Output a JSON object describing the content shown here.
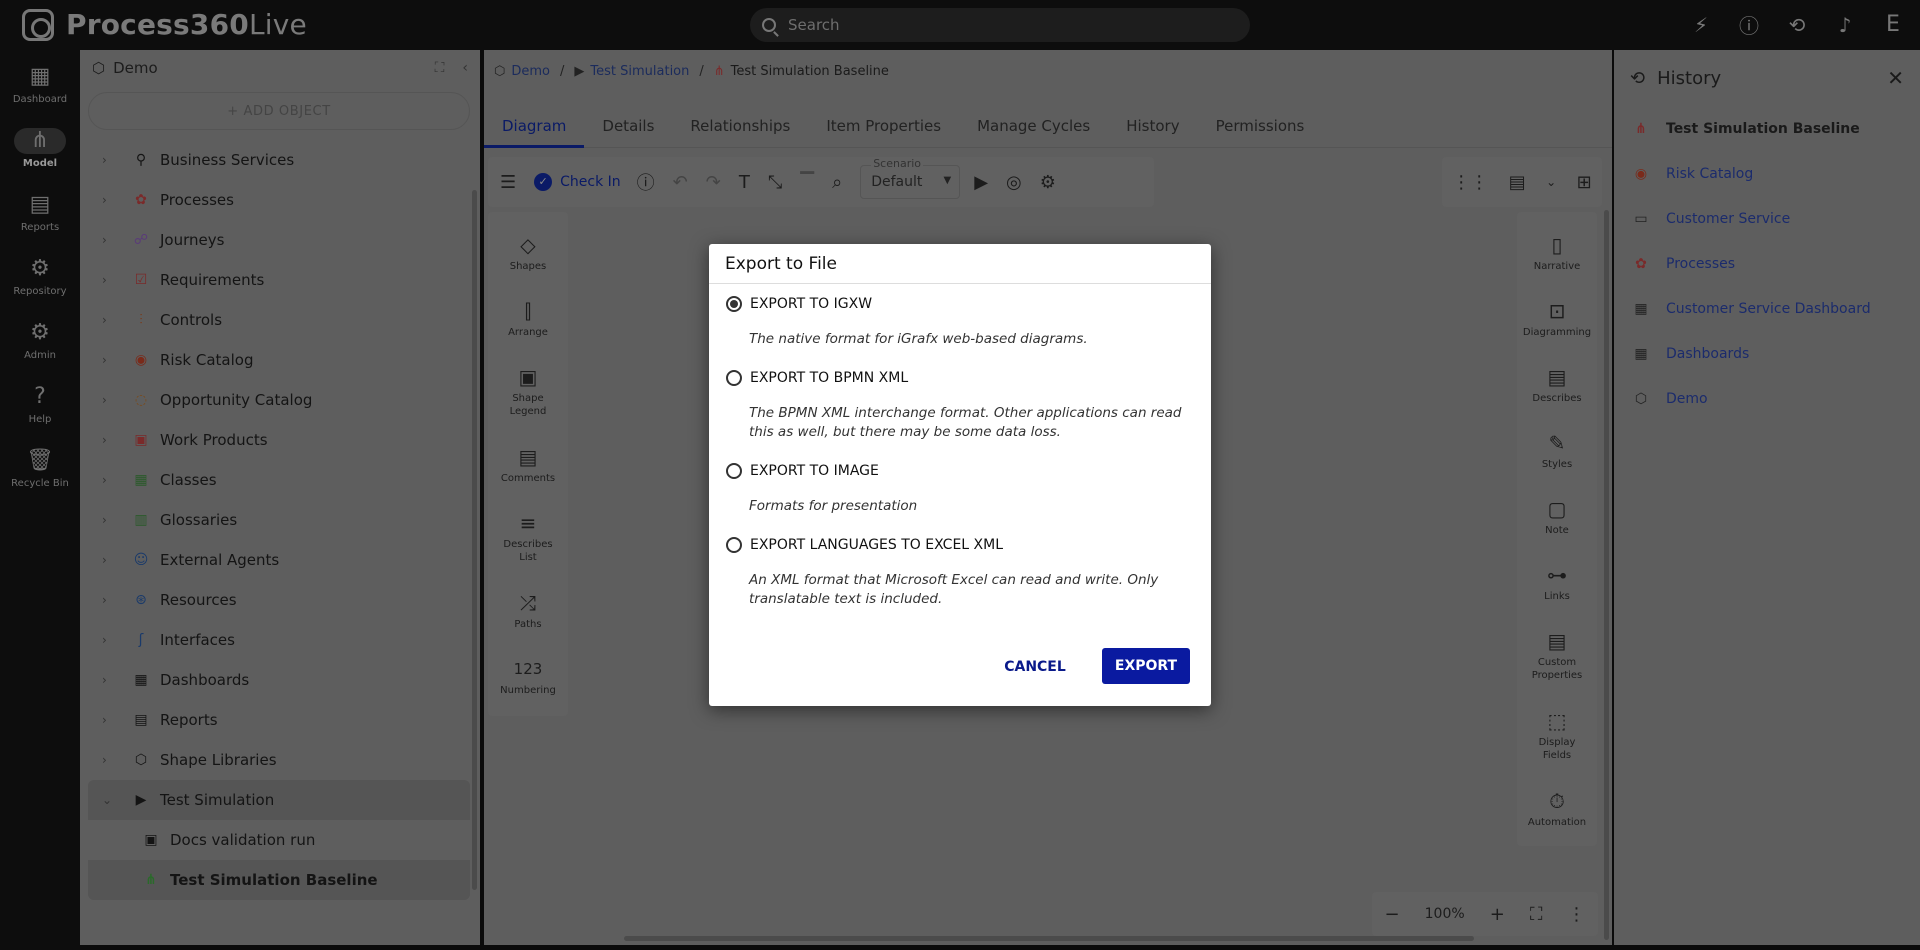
{
  "app": {
    "logo_bold": "Process360",
    "logo_thin": "Live",
    "search_placeholder": "Search",
    "avatar_letter": "E"
  },
  "leftnav": [
    {
      "label": "Dashboard",
      "icon": "dashboard-icon"
    },
    {
      "label": "Model",
      "icon": "model-icon"
    },
    {
      "label": "Reports",
      "icon": "reports-icon"
    },
    {
      "label": "Repository",
      "icon": "gear-icon"
    },
    {
      "label": "Admin",
      "icon": "admin-icon"
    },
    {
      "label": "Help",
      "icon": "help-icon"
    },
    {
      "label": "Recycle Bin",
      "icon": "trash-icon"
    }
  ],
  "leftpanel": {
    "title": "Demo",
    "add_object": "+ ADD OBJECT",
    "tree": [
      {
        "label": "Business Services",
        "icon": "business-services-icon"
      },
      {
        "label": "Processes",
        "icon": "processes-icon"
      },
      {
        "label": "Journeys",
        "icon": "journeys-icon"
      },
      {
        "label": "Requirements",
        "icon": "requirements-icon"
      },
      {
        "label": "Controls",
        "icon": "controls-icon"
      },
      {
        "label": "Risk Catalog",
        "icon": "risk-icon"
      },
      {
        "label": "Opportunity Catalog",
        "icon": "opportunity-icon"
      },
      {
        "label": "Work Products",
        "icon": "work-products-icon"
      },
      {
        "label": "Classes",
        "icon": "classes-icon"
      },
      {
        "label": "Glossaries",
        "icon": "glossaries-icon"
      },
      {
        "label": "External Agents",
        "icon": "external-agents-icon"
      },
      {
        "label": "Resources",
        "icon": "resources-icon"
      },
      {
        "label": "Interfaces",
        "icon": "interfaces-icon"
      },
      {
        "label": "Dashboards",
        "icon": "dashboards-icon"
      },
      {
        "label": "Reports",
        "icon": "reports-icon"
      },
      {
        "label": "Shape Libraries",
        "icon": "shape-libraries-icon"
      }
    ],
    "expanded": {
      "label": "Test Simulation"
    },
    "children": [
      {
        "label": "Docs validation run"
      },
      {
        "label": "Test Simulation Baseline"
      }
    ]
  },
  "breadcrumb": {
    "root": "Demo",
    "parent": "Test Simulation",
    "current": "Test Simulation Baseline"
  },
  "tabs": [
    "Diagram",
    "Details",
    "Relationships",
    "Item Properties",
    "Manage Cycles",
    "History",
    "Permissions"
  ],
  "toolbar": {
    "check_in": "Check In",
    "scenario_label": "Scenario",
    "scenario_value": "Default"
  },
  "sidebar_left": [
    {
      "label": "Shapes",
      "icon": "shapes-icon"
    },
    {
      "label": "Arrange",
      "icon": "arrange-icon"
    },
    {
      "label": "Shape Legend",
      "icon": "shape-legend-icon"
    },
    {
      "label": "Comments",
      "icon": "comments-icon"
    },
    {
      "label": "Describes List",
      "icon": "describes-list-icon"
    },
    {
      "label": "Paths",
      "icon": "paths-icon"
    },
    {
      "label": "Numbering",
      "icon": "numbering-icon"
    }
  ],
  "sidebar_right": [
    {
      "label": "Narrative",
      "icon": "narrative-icon"
    },
    {
      "label": "Diagramming",
      "icon": "diagramming-icon"
    },
    {
      "label": "Describes",
      "icon": "describes-icon"
    },
    {
      "label": "Styles",
      "icon": "styles-icon"
    },
    {
      "label": "Note",
      "icon": "note-icon"
    },
    {
      "label": "Links",
      "icon": "links-icon"
    },
    {
      "label": "Custom Properties",
      "icon": "custom-properties-icon"
    },
    {
      "label": "Display Fields",
      "icon": "display-fields-icon"
    },
    {
      "label": "Automation",
      "icon": "automation-icon"
    }
  ],
  "numbering_glyph": "123",
  "zoom": {
    "level": "100%"
  },
  "history": {
    "title": "History",
    "items": [
      {
        "label": "Test Simulation Baseline",
        "icon": "simulation-icon"
      },
      {
        "label": "Risk Catalog",
        "icon": "risk-icon"
      },
      {
        "label": "Customer Service",
        "icon": "folder-icon"
      },
      {
        "label": "Processes",
        "icon": "processes-icon"
      },
      {
        "label": "Customer Service Dashboard",
        "icon": "dashboard-icon"
      },
      {
        "label": "Dashboards",
        "icon": "dashboards-icon"
      },
      {
        "label": "Demo",
        "icon": "cube-icon"
      }
    ]
  },
  "modal": {
    "title": "Export to File",
    "options": [
      {
        "label": "EXPORT TO IGXW",
        "desc": "The native format for iGrafx web-based diagrams.",
        "checked": true
      },
      {
        "label": "EXPORT TO BPMN XML",
        "desc": "The BPMN XML interchange format. Other applications can read this as well, but there may be some data loss.",
        "checked": false
      },
      {
        "label": "EXPORT TO IMAGE",
        "desc": "Formats for presentation",
        "checked": false
      },
      {
        "label": "EXPORT LANGUAGES TO EXCEL XML",
        "desc": "An XML format that Microsoft Excel can read and write. Only translatable text is included.",
        "checked": false
      }
    ],
    "cancel": "CANCEL",
    "export": "EXPORT"
  }
}
